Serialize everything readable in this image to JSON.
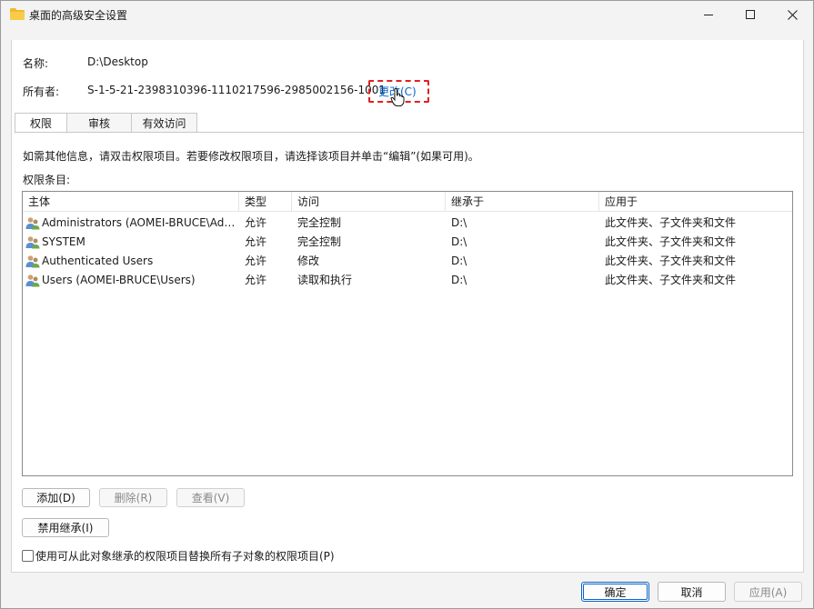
{
  "window": {
    "title": "桌面的高级安全设置",
    "icon": "folder-icon"
  },
  "fields": {
    "name_label": "名称:",
    "name_value": "D:\\Desktop",
    "owner_label": "所有者:",
    "owner_value": "S-1-5-21-2398310396-1110217596-2985002156-1001",
    "change_link": "更改(C)"
  },
  "tabs": [
    {
      "label": "权限",
      "active": true
    },
    {
      "label": "审核",
      "active": false
    },
    {
      "label": "有效访问",
      "active": false
    }
  ],
  "info_text": "如需其他信息，请双击权限项目。若要修改权限项目，请选择该项目并单击“编辑”(如果可用)。",
  "entries_label": "权限条目:",
  "table": {
    "columns": [
      "主体",
      "类型",
      "访问",
      "继承于",
      "应用于"
    ],
    "rows": [
      {
        "principal": "Administrators (AOMEI-BRUCE\\Administrators)",
        "type": "允许",
        "access": "完全控制",
        "inherited": "D:\\",
        "applies": "此文件夹、子文件夹和文件"
      },
      {
        "principal": "SYSTEM",
        "type": "允许",
        "access": "完全控制",
        "inherited": "D:\\",
        "applies": "此文件夹、子文件夹和文件"
      },
      {
        "principal": "Authenticated Users",
        "type": "允许",
        "access": "修改",
        "inherited": "D:\\",
        "applies": "此文件夹、子文件夹和文件"
      },
      {
        "principal": "Users (AOMEI-BRUCE\\Users)",
        "type": "允许",
        "access": "读取和执行",
        "inherited": "D:\\",
        "applies": "此文件夹、子文件夹和文件"
      }
    ]
  },
  "buttons": {
    "add": "添加(D)",
    "remove": "删除(R)",
    "view": "查看(V)",
    "disable_inheritance": "禁用继承(I)",
    "ok": "确定",
    "cancel": "取消",
    "apply": "应用(A)"
  },
  "replace_checkbox": {
    "label": "使用可从此对象继承的权限项目替换所有子对象的权限项目(P)",
    "checked": false
  },
  "colors": {
    "accent": "#0a64c8",
    "highlight": "#e02020"
  }
}
